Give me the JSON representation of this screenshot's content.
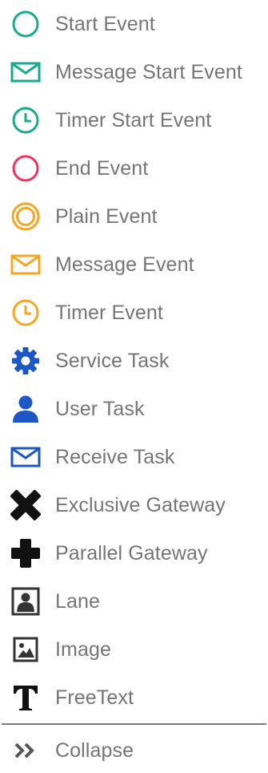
{
  "palette": {
    "items": [
      {
        "label": "Start Event"
      },
      {
        "label": "Message Start Event"
      },
      {
        "label": "Timer Start Event"
      },
      {
        "label": "End Event"
      },
      {
        "label": "Plain Event"
      },
      {
        "label": "Message Event"
      },
      {
        "label": "Timer Event"
      },
      {
        "label": "Service Task"
      },
      {
        "label": "User Task"
      },
      {
        "label": "Receive Task"
      },
      {
        "label": "Exclusive Gateway"
      },
      {
        "label": "Parallel Gateway"
      },
      {
        "label": "Lane"
      },
      {
        "label": "Image"
      },
      {
        "label": "FreeText"
      }
    ],
    "collapse_label": "Collapse"
  },
  "colors": {
    "start": "#1aaa8c",
    "end": "#f0345f",
    "event": "#f5a623",
    "task": "#1d57c4",
    "gateway": "#111111",
    "dark": "#333333",
    "text": "#757575"
  }
}
